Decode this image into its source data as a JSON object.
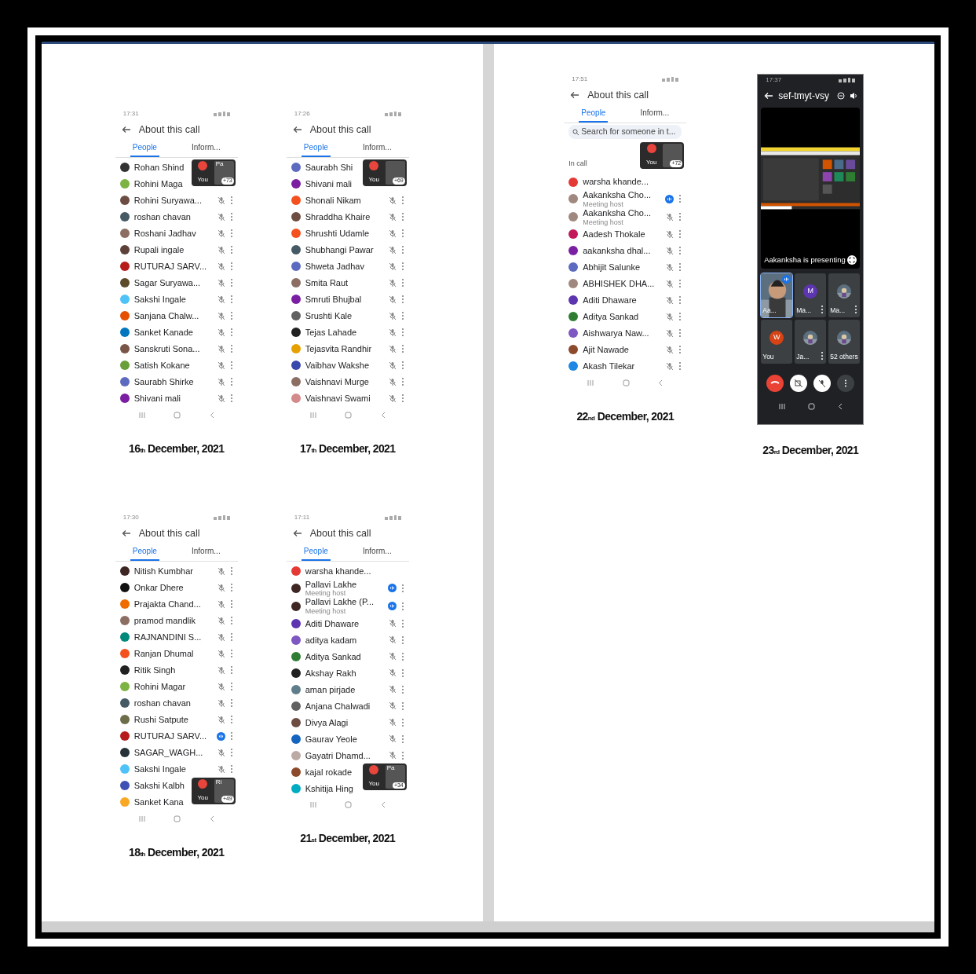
{
  "pages": [
    {
      "shots": [
        {
          "kind": "people",
          "time": "17:31",
          "title": "About this call",
          "tabs": [
            {
              "label": "People",
              "selected": true
            },
            {
              "label": "Inform...",
              "selected": false
            }
          ],
          "participants": [
            {
              "name": "Rohan Shind",
              "color": "#333333",
              "muted": false,
              "speaking": false,
              "overlaid": true
            },
            {
              "name": "Rohini Maga",
              "color": "#7cb342",
              "muted": false,
              "speaking": false,
              "overlaid": false
            },
            {
              "name": "Rohini Suryawa...",
              "color": "#6d4c41",
              "muted": true,
              "speaking": false,
              "overlaid": false
            },
            {
              "name": "roshan chavan",
              "color": "#455a64",
              "muted": true,
              "speaking": false,
              "overlaid": false
            },
            {
              "name": "Roshani Jadhav",
              "color": "#8d6e63",
              "muted": true,
              "speaking": false,
              "overlaid": false
            },
            {
              "name": "Rupali ingale",
              "color": "#5d4037",
              "muted": true,
              "speaking": false,
              "overlaid": false
            },
            {
              "name": "RUTURAJ SARV...",
              "color": "#b71c1c",
              "muted": true,
              "speaking": false,
              "overlaid": false
            },
            {
              "name": "Sagar Suryawa...",
              "color": "#5d4a2a",
              "muted": true,
              "speaking": false,
              "overlaid": false
            },
            {
              "name": "Sakshi Ingale",
              "color": "#4fc3f7",
              "muted": true,
              "speaking": false,
              "overlaid": false
            },
            {
              "name": "Sanjana Chalw...",
              "color": "#e65100",
              "muted": true,
              "speaking": false,
              "overlaid": false
            },
            {
              "name": "Sanket Kanade",
              "color": "#0277bd",
              "muted": true,
              "speaking": false,
              "overlaid": false
            },
            {
              "name": "Sanskruti Sona...",
              "color": "#795548",
              "muted": true,
              "speaking": false,
              "overlaid": false
            },
            {
              "name": "Satish Kokane",
              "color": "#689f38",
              "muted": true,
              "speaking": false,
              "overlaid": false
            },
            {
              "name": "Saurabh Shirke",
              "color": "#5c6bc0",
              "muted": true,
              "speaking": false,
              "overlaid": false
            },
            {
              "name": "Shivani mali",
              "color": "#7b1fa2",
              "muted": true,
              "speaking": false,
              "overlaid": false
            }
          ],
          "overlay": {
            "you": "You",
            "other": "Pa",
            "count": "+73"
          },
          "caption": "16$_{th}$ December, 2021"
        },
        {
          "kind": "people",
          "time": "17:26",
          "title": "About this call",
          "tabs": [
            {
              "label": "People",
              "selected": true
            },
            {
              "label": "Inform...",
              "selected": false
            }
          ],
          "participants": [
            {
              "name": "Saurabh Shi",
              "color": "#5c6bc0",
              "muted": false,
              "speaking": false,
              "overlaid": true
            },
            {
              "name": "Shivani mali",
              "color": "#7b1fa2",
              "muted": false,
              "speaking": false,
              "overlaid": false
            },
            {
              "name": "Shonali Nikam",
              "color": "#f4511e",
              "muted": true,
              "speaking": false,
              "overlaid": false
            },
            {
              "name": "Shraddha Khaire",
              "color": "#6d4c41",
              "muted": true,
              "speaking": false,
              "overlaid": false
            },
            {
              "name": "Shrushti Udamle",
              "color": "#f4511e",
              "muted": true,
              "speaking": false,
              "overlaid": false
            },
            {
              "name": "Shubhangi Pawar",
              "color": "#455a64",
              "muted": true,
              "speaking": false,
              "overlaid": false
            },
            {
              "name": "Shweta Jadhav",
              "color": "#5c6bc0",
              "muted": true,
              "speaking": false,
              "overlaid": false
            },
            {
              "name": "Smita Raut",
              "color": "#8d6e63",
              "muted": true,
              "speaking": false,
              "overlaid": false
            },
            {
              "name": "Smruti Bhujbal",
              "color": "#7b1fa2",
              "muted": true,
              "speaking": false,
              "overlaid": false
            },
            {
              "name": "Srushti Kale",
              "color": "#616161",
              "muted": true,
              "speaking": false,
              "overlaid": false
            },
            {
              "name": "Tejas Lahade",
              "color": "#212121",
              "muted": true,
              "speaking": false,
              "overlaid": false
            },
            {
              "name": "Tejasvita Randhir",
              "color": "#e6a100",
              "muted": true,
              "speaking": false,
              "overlaid": false
            },
            {
              "name": "Vaibhav Wakshe",
              "color": "#3949ab",
              "muted": true,
              "speaking": false,
              "overlaid": false
            },
            {
              "name": "Vaishnavi Murge",
              "color": "#8d6e63",
              "muted": true,
              "speaking": false,
              "overlaid": false
            },
            {
              "name": "Vaishnavi Swami",
              "color": "#d48a8a",
              "muted": true,
              "speaking": false,
              "overlaid": false
            }
          ],
          "overlay": {
            "you": "You",
            "count": "+69"
          },
          "caption": "17$_{th}$ December, 2021"
        },
        {
          "kind": "people",
          "time": "17:30",
          "title": "About this call",
          "tabs": [
            {
              "label": "People",
              "selected": true
            },
            {
              "label": "Inform...",
              "selected": false
            }
          ],
          "participants": [
            {
              "name": "Nitish Kumbhar",
              "color": "#3e2723",
              "muted": true,
              "speaking": false,
              "overlaid": false
            },
            {
              "name": "Onkar Dhere",
              "color": "#111111",
              "muted": true,
              "speaking": false,
              "overlaid": false
            },
            {
              "name": "Prajakta Chand...",
              "color": "#ef6c00",
              "muted": true,
              "speaking": false,
              "overlaid": false
            },
            {
              "name": "pramod mandlik",
              "color": "#8d6e63",
              "muted": true,
              "speaking": false,
              "overlaid": false
            },
            {
              "name": "RAJNANDINI S...",
              "color": "#00897b",
              "muted": true,
              "speaking": false,
              "overlaid": false
            },
            {
              "name": "Ranjan Dhumal",
              "color": "#f4511e",
              "muted": true,
              "speaking": false,
              "overlaid": false
            },
            {
              "name": "Ritik Singh",
              "color": "#212121",
              "muted": true,
              "speaking": false,
              "overlaid": false
            },
            {
              "name": "Rohini Magar",
              "color": "#7cb342",
              "muted": true,
              "speaking": false,
              "overlaid": false
            },
            {
              "name": "roshan chavan",
              "color": "#455a64",
              "muted": true,
              "speaking": false,
              "overlaid": false
            },
            {
              "name": "Rushi Satpute",
              "color": "#6d6d4a",
              "muted": true,
              "speaking": false,
              "overlaid": false
            },
            {
              "name": "RUTURAJ SARV...",
              "color": "#b71c1c",
              "muted": false,
              "speaking": true,
              "overlaid": false
            },
            {
              "name": "SAGAR_WAGH...",
              "color": "#263238",
              "muted": true,
              "speaking": false,
              "overlaid": false
            },
            {
              "name": "Sakshi Ingale",
              "color": "#4fc3f7",
              "muted": true,
              "speaking": false,
              "overlaid": false
            },
            {
              "name": "Sakshi Kalbh",
              "color": "#3f51b5",
              "muted": false,
              "speaking": false,
              "overlaid": true
            },
            {
              "name": "Sanket Kana",
              "color": "#f9a825",
              "muted": false,
              "speaking": false,
              "overlaid": false
            }
          ],
          "overlay": {
            "you": "You",
            "other": "Ri",
            "count": "+49"
          },
          "caption": "18$_{th}$ December, 2021"
        },
        {
          "kind": "people",
          "time": "17:11",
          "title": "About this call",
          "tabs": [
            {
              "label": "People",
              "selected": true
            },
            {
              "label": "Inform...",
              "selected": false
            }
          ],
          "participants": [
            {
              "name": "warsha khande...",
              "color": "#e53935",
              "muted": false,
              "speaking": false,
              "overlaid": false
            },
            {
              "name": "Pallavi Lakhe",
              "role": "Meeting host",
              "color": "#3e2723",
              "muted": false,
              "speaking": true,
              "overlaid": false
            },
            {
              "name": "Pallavi Lakhe (P...",
              "role": "Meeting host",
              "color": "#3e2723",
              "muted": false,
              "speaking": true,
              "overlaid": false
            },
            {
              "name": "Aditi Dhaware",
              "color": "#5e35b1",
              "muted": true,
              "speaking": false,
              "overlaid": false
            },
            {
              "name": "aditya kadam",
              "color": "#7e57c2",
              "muted": true,
              "speaking": false,
              "overlaid": false
            },
            {
              "name": "Aditya Sankad",
              "color": "#2e7d32",
              "muted": true,
              "speaking": false,
              "overlaid": false
            },
            {
              "name": "Akshay Rakh",
              "color": "#212121",
              "muted": true,
              "speaking": false,
              "overlaid": false
            },
            {
              "name": "aman pirjade",
              "color": "#607d8b",
              "muted": true,
              "speaking": false,
              "overlaid": false
            },
            {
              "name": "Anjana Chalwadi",
              "color": "#616161",
              "muted": true,
              "speaking": false,
              "overlaid": false
            },
            {
              "name": "Divya Alagi",
              "color": "#6d4c41",
              "muted": true,
              "speaking": false,
              "overlaid": false
            },
            {
              "name": "Gaurav Yeole",
              "color": "#1565c0",
              "muted": true,
              "speaking": false,
              "overlaid": false
            },
            {
              "name": "Gayatri Dhamd...",
              "color": "#bcaaa4",
              "muted": true,
              "speaking": false,
              "overlaid": false
            },
            {
              "name": "kajal rokade",
              "color": "#8d4a2a",
              "muted": false,
              "speaking": false,
              "overlaid": true
            },
            {
              "name": "Kshitija Hing",
              "color": "#00acc1",
              "muted": false,
              "speaking": false,
              "overlaid": false
            }
          ],
          "overlay": {
            "you": "You",
            "other": "Pa",
            "count": "+34"
          },
          "caption": "21$_{st}$ December, 2021"
        }
      ]
    },
    {
      "shots": [
        {
          "kind": "people",
          "time": "17:51",
          "title": "About this call",
          "tabs": [
            {
              "label": "People",
              "selected": true
            },
            {
              "label": "Inform...",
              "selected": false
            }
          ],
          "search": {
            "placeholder": "Search for someone in t..."
          },
          "section": {
            "label": "In call",
            "overlaid": true
          },
          "participants": [
            {
              "name": "warsha khande...",
              "color": "#e53935",
              "muted": false,
              "speaking": false,
              "overlaid": false
            },
            {
              "name": "Aakanksha Cho...",
              "role": "Meeting host",
              "color": "#a1887f",
              "muted": false,
              "speaking": true,
              "overlaid": false
            },
            {
              "name": "Aakanksha Cho...",
              "role": "Meeting host",
              "color": "#a1887f",
              "muted": true,
              "speaking": false,
              "overlaid": false
            },
            {
              "name": "Aadesh Thokale",
              "color": "#c2185b",
              "muted": true,
              "speaking": false,
              "overlaid": false
            },
            {
              "name": "aakanksha dhal...",
              "color": "#7b1fa2",
              "muted": true,
              "speaking": false,
              "overlaid": false
            },
            {
              "name": "Abhijit Salunke",
              "color": "#5c6bc0",
              "muted": true,
              "speaking": false,
              "overlaid": false
            },
            {
              "name": "ABHISHEK DHA...",
              "color": "#a1887f",
              "muted": true,
              "speaking": false,
              "overlaid": false
            },
            {
              "name": "Aditi Dhaware",
              "color": "#5e35b1",
              "muted": true,
              "speaking": false,
              "overlaid": false
            },
            {
              "name": "Aditya Sankad",
              "color": "#2e7d32",
              "muted": true,
              "speaking": false,
              "overlaid": false
            },
            {
              "name": "Aishwarya Naw...",
              "color": "#7e57c2",
              "muted": true,
              "speaking": false,
              "overlaid": false
            },
            {
              "name": "Ajit Nawade",
              "color": "#8d4a2a",
              "muted": true,
              "speaking": false,
              "overlaid": false
            },
            {
              "name": "Akash Tilekar",
              "color": "#1e88e5",
              "muted": true,
              "speaking": false,
              "overlaid": false
            }
          ],
          "overlay": {
            "you": "You",
            "count": "+72"
          },
          "caption": "22$_{nd}$ December, 2021"
        },
        {
          "kind": "meeting",
          "time": "17:37",
          "title": "sef-tmyt-vsy",
          "presenting": "Aakanksha  is presenting",
          "tiles": [
            {
              "label": "Aa...",
              "kind": "video",
              "speaking": true,
              "menu": false
            },
            {
              "label": "Ma...",
              "kind": "avatar",
              "letter": "M",
              "color": "#5e35b1",
              "speaking": false,
              "menu": true
            },
            {
              "label": "Ma...",
              "speaking": false,
              "menu": true
            },
            {
              "label": "You",
              "kind": "avatar",
              "letter": "W",
              "color": "#d84315",
              "speaking": false,
              "menu": false
            },
            {
              "label": "Ja...",
              "speaking": false,
              "menu": true
            },
            {
              "label": "52 others",
              "speaking": false,
              "menu": false
            }
          ],
          "caption": "23$_{rd}$ December, 2021"
        }
      ]
    }
  ]
}
